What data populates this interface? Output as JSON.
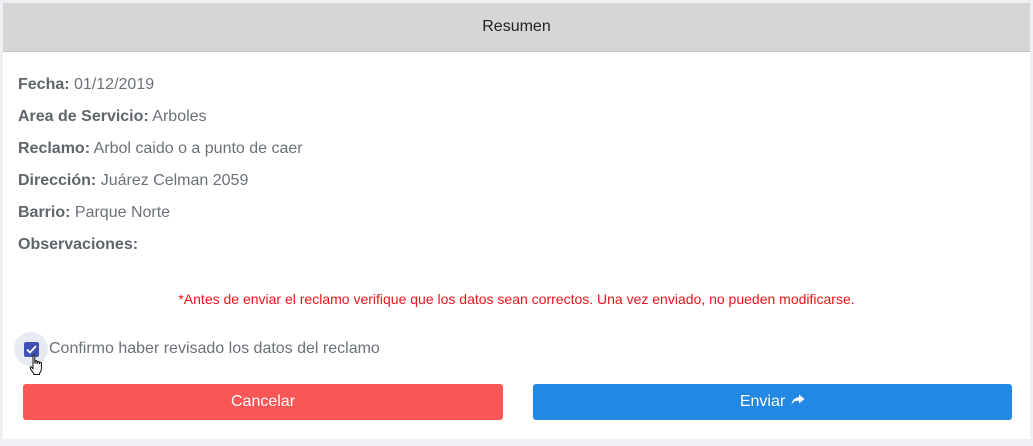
{
  "header": {
    "title": "Resumen"
  },
  "fields": [
    {
      "label": "Fecha:",
      "value": "01/12/2019"
    },
    {
      "label": "Area de Servicio:",
      "value": "Arboles"
    },
    {
      "label": "Reclamo:",
      "value": "Arbol caido o a punto de caer"
    },
    {
      "label": "Dirección:",
      "value": "Juárez Celman 2059"
    },
    {
      "label": "Barrio:",
      "value": "Parque Norte"
    },
    {
      "label": "Observaciones:",
      "value": ""
    }
  ],
  "warning": "*Antes de enviar el reclamo verifique que los datos sean correctos. Una vez enviado, no pueden modificarse.",
  "confirm": {
    "label": "Confirmo haber revisado los datos del reclamo",
    "checked": true
  },
  "buttons": {
    "cancel": "Cancelar",
    "send": "Enviar"
  },
  "colors": {
    "cancel": "#f95656",
    "send": "#2188e4",
    "warning": "#e8141b",
    "checkbox": "#3f51b5"
  }
}
